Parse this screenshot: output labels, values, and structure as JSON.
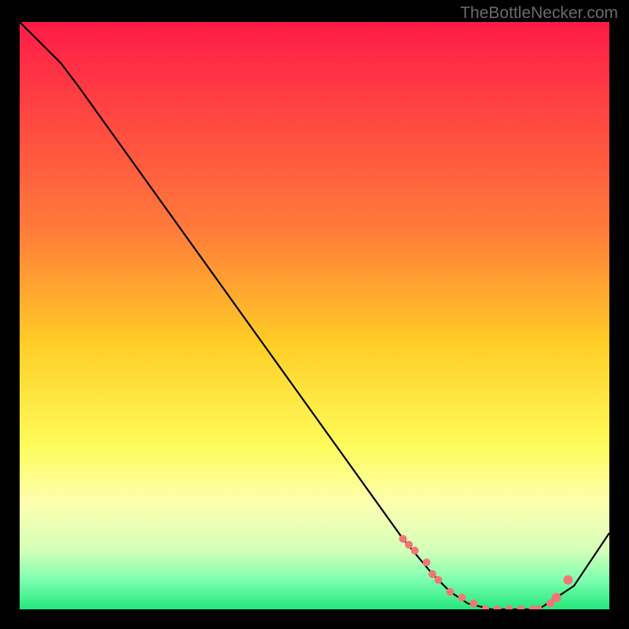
{
  "watermark": "TheBottleNecker.com",
  "colors": {
    "page_bg": "#000000",
    "line": "#000000",
    "marker": "#f27774",
    "gradient_stops": [
      {
        "offset": 0,
        "color": "#ff1b47"
      },
      {
        "offset": 35,
        "color": "#ff7a3a"
      },
      {
        "offset": 55,
        "color": "#ffce27"
      },
      {
        "offset": 72,
        "color": "#fdfc5a"
      },
      {
        "offset": 82,
        "color": "#fdffb0"
      },
      {
        "offset": 90,
        "color": "#d4ffb8"
      },
      {
        "offset": 95,
        "color": "#7dffb0"
      },
      {
        "offset": 100,
        "color": "#23e77c"
      }
    ]
  },
  "chart_data": {
    "type": "line",
    "title": "",
    "xlabel": "",
    "ylabel": "",
    "xlim": [
      0,
      100
    ],
    "ylim": [
      0,
      100
    ],
    "x": [
      0,
      7,
      10,
      15,
      20,
      25,
      30,
      35,
      40,
      45,
      50,
      55,
      60,
      65,
      70,
      73,
      76,
      80,
      84,
      88,
      91,
      94,
      100
    ],
    "values": [
      100,
      93,
      89,
      82,
      75,
      68,
      61,
      54,
      47,
      40,
      33,
      26,
      19,
      12,
      6,
      3,
      1,
      0,
      0,
      0,
      2,
      4,
      13
    ],
    "markers": {
      "x": [
        65,
        66,
        67,
        69,
        70,
        71,
        73,
        75,
        77,
        79,
        81,
        83,
        85,
        87,
        88,
        90,
        91,
        93
      ],
      "y": [
        12,
        11,
        10,
        8,
        6,
        5,
        3,
        2,
        1,
        0,
        0,
        0,
        0,
        0,
        0,
        1,
        2,
        5
      ],
      "r": [
        5,
        5,
        5,
        5,
        5,
        5,
        5,
        5,
        5,
        5,
        5,
        5,
        5,
        5,
        5,
        5,
        6,
        6
      ]
    }
  }
}
